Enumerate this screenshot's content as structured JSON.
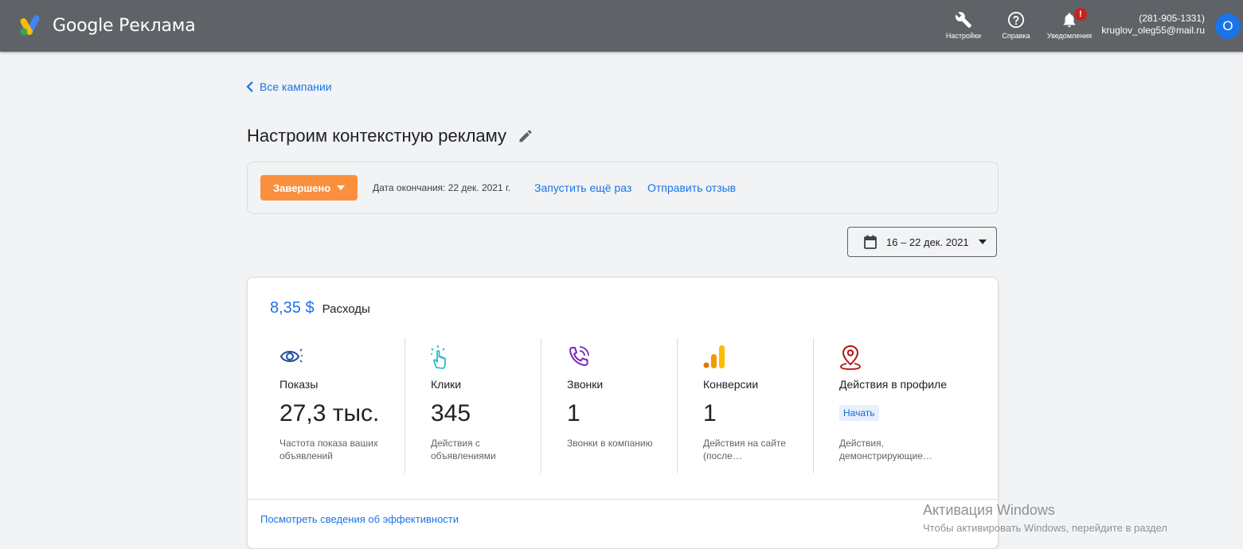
{
  "header": {
    "brand": "Google Реклама",
    "settings_label": "Настройки",
    "help_label": "Справка",
    "notifications_label": "Уведомления",
    "notifications_badge": "!",
    "account_phone": "(281-905-1331)",
    "account_email": "kruglov_oleg55@mail.ru",
    "avatar_letter": "O"
  },
  "nav": {
    "back_label": "Все кампании"
  },
  "campaign": {
    "title": "Настроим контекстную рекламу",
    "status": "Завершено",
    "end_date": "Дата окончания: 22 дек. 2021 г.",
    "relaunch_label": "Запустить ещё раз",
    "feedback_label": "Отправить отзыв",
    "date_range": "16 – 22 дек. 2021"
  },
  "summary": {
    "spend_value": "8,35 $",
    "spend_label": "Расходы",
    "metrics": [
      {
        "name": "Показы",
        "value": "27,3 тыс.",
        "desc": "Частота показа ваших объявлений",
        "icon": "eye-icon"
      },
      {
        "name": "Клики",
        "value": "345",
        "desc": "Действия с объявлениями",
        "icon": "tap-icon"
      },
      {
        "name": "Звонки",
        "value": "1",
        "desc": "Звонки в компанию",
        "icon": "phone-call-icon"
      },
      {
        "name": "Конверсии",
        "value": "1",
        "desc": "Действия на сайте (после…",
        "icon": "analytics-bars-icon"
      },
      {
        "name": "Действия в профиле",
        "start_label": "Начать",
        "desc": "Действия, демонстрирующие…",
        "icon": "location-pin-icon"
      }
    ],
    "performance_link": "Посмотреть сведения об эффективности"
  },
  "watermark": {
    "line1": "Активация Windows",
    "line2": "Чтобы активировать Windows, перейдите в раздел"
  },
  "colors": {
    "topbar": "#5f6368",
    "accent": "#1a73e8",
    "status_orange": "#fa903e",
    "badge_red": "#c5221f"
  }
}
